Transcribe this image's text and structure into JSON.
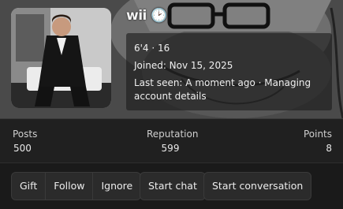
{
  "cover": {
    "overlay_text": "wii 🕑"
  },
  "profile": {
    "line1": "6'4 · 16",
    "joined": "Joined: Nov 15, 2025",
    "last_seen_1": "Last seen: A moment ago · Managing",
    "last_seen_2": "account details"
  },
  "stats": {
    "posts_label": "Posts",
    "posts_value": "500",
    "reputation_label": "Reputation",
    "reputation_value": "599",
    "points_label": "Points",
    "points_value": "8"
  },
  "actions": {
    "gift": "Gift",
    "follow": "Follow",
    "ignore": "Ignore",
    "start_chat": "Start chat",
    "start_conversation": "Start conversation"
  }
}
